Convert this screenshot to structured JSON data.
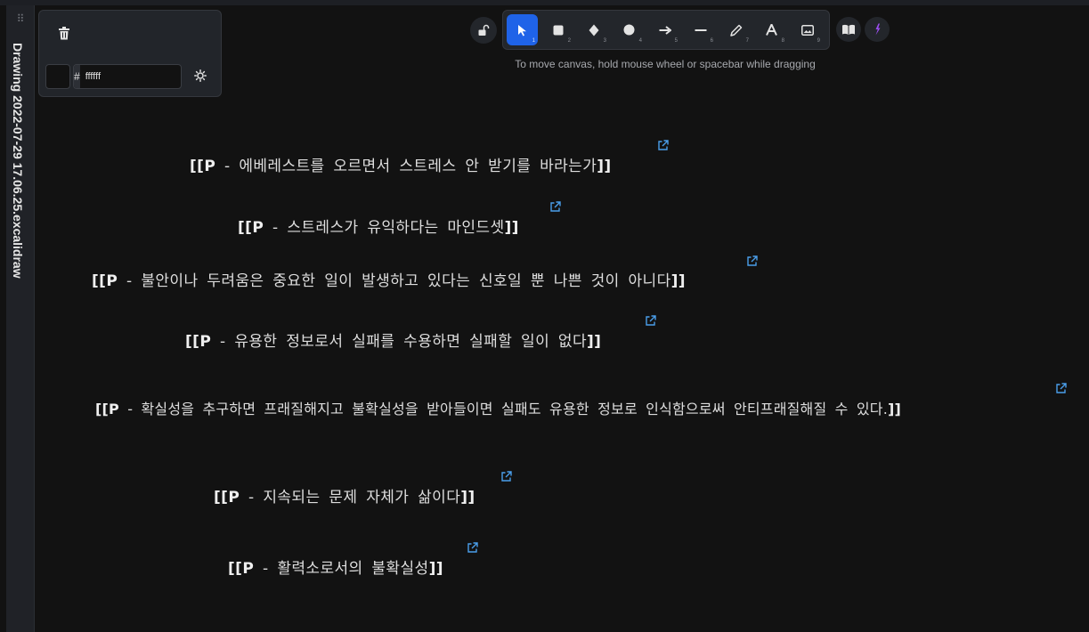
{
  "sidebar": {
    "handle": "⠿",
    "title": "Drawing 2022-07-29 17.06.25.excalidraw"
  },
  "properties": {
    "hash": "#",
    "color_value": "ffffff"
  },
  "toolbar": {
    "tools": [
      {
        "name": "selection",
        "key": "1"
      },
      {
        "name": "rectangle",
        "key": "2"
      },
      {
        "name": "diamond",
        "key": "3"
      },
      {
        "name": "ellipse",
        "key": "4"
      },
      {
        "name": "arrow",
        "key": "5"
      },
      {
        "name": "line",
        "key": "6"
      },
      {
        "name": "draw",
        "key": "7"
      },
      {
        "name": "text",
        "key": "8"
      },
      {
        "name": "image",
        "key": "9"
      }
    ],
    "hint": "To move canvas, hold mouse wheel or spacebar while dragging"
  },
  "canvas": {
    "items": [
      {
        "open": "[[P",
        "text": " - 에베레스트를 오르면서 스트레스 안 받기를 바라는가",
        "close": "]]"
      },
      {
        "open": "[[P",
        "text": " - 스트레스가 유익하다는 마인드셋",
        "close": "]]"
      },
      {
        "open": "[[P",
        "text": " - 불안이나 두려움은 중요한 일이 발생하고 있다는 신호일 뿐 나쁜 것이 아니다",
        "close": "]]"
      },
      {
        "open": "[[P",
        "text": " - 유용한 정보로서 실패를 수용하면 실패할 일이 없다",
        "close": "]]"
      },
      {
        "open": "[[P",
        "text": " - 확실성을 추구하면 프래질해지고 불확실성을 받아들이면 실패도 유용한 정보로 인식함으로써 안티프래질해질 수 있다.",
        "close": "]]"
      },
      {
        "open": "[[P",
        "text": " - 지속되는 문제 자체가 삶이다",
        "close": "]]"
      },
      {
        "open": "[[P",
        "text": " - 활력소로서의 불확실성",
        "close": "]]"
      }
    ]
  },
  "colors": {
    "background": "#121212",
    "accent": "#1f63e8",
    "link": "#4a9eea"
  }
}
